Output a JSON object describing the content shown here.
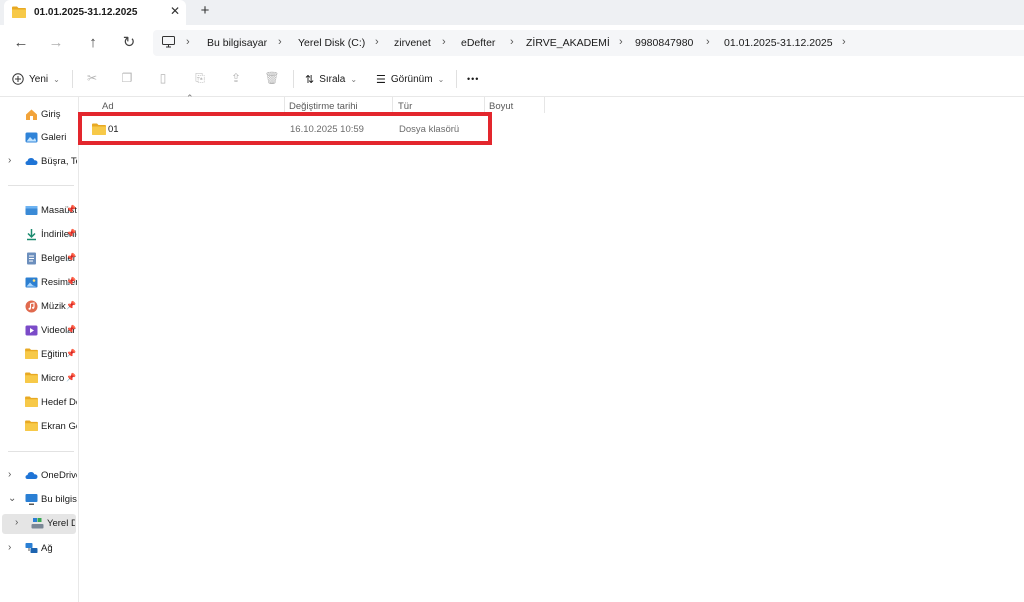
{
  "tab": {
    "title": "01.01.2025-31.12.2025",
    "close_glyph": "✕",
    "new_tab_glyph": "+"
  },
  "nav": {
    "back": "←",
    "forward": "→",
    "up": "↑",
    "refresh": "↻"
  },
  "breadcrumb": [
    "Bu bilgisayar",
    "Yerel Disk (C:)",
    "zirvenet",
    "eDefter",
    "ZİRVE_AKADEMİ",
    "9980847980",
    "01.01.2025-31.12.2025"
  ],
  "breadcrumb_sep": "›",
  "commandbar": {
    "new_label": "Yeni",
    "sort_label": "Sırala",
    "view_label": "Görünüm",
    "more": "•••",
    "icons": [
      "cut-icon",
      "copy-icon",
      "paste-icon",
      "rename-icon",
      "share-icon",
      "delete-icon"
    ]
  },
  "sidebar": {
    "items": [
      {
        "label": "Giriş",
        "icon": "home-icon"
      },
      {
        "label": "Galeri",
        "icon": "gallery-icon"
      },
      {
        "label": "Büşra, Te",
        "icon": "onedrive-icon"
      },
      {
        "label": "Masaüstü",
        "icon": "desktop-icon"
      },
      {
        "label": "İndirilenler",
        "icon": "download-icon"
      },
      {
        "label": "Belgeler",
        "icon": "documents-icon"
      },
      {
        "label": "Resimler",
        "icon": "pictures-icon"
      },
      {
        "label": "Müzik",
        "icon": "music-icon"
      },
      {
        "label": "Videolar",
        "icon": "videos-icon"
      },
      {
        "label": "Eğitim",
        "icon": "folder-icon"
      },
      {
        "label": "Micro",
        "icon": "folder-icon"
      },
      {
        "label": "Hedef De",
        "icon": "folder-icon"
      },
      {
        "label": "Ekran Gö",
        "icon": "folder-icon"
      },
      {
        "label": "OneDrive",
        "icon": "onedrive-icon"
      },
      {
        "label": "Bu bilgis",
        "icon": "pc-icon"
      },
      {
        "label": "Yerel Di",
        "icon": "drive-icon"
      },
      {
        "label": "Ağ",
        "icon": "network-icon"
      }
    ],
    "pin_glyph": "📌"
  },
  "columns": {
    "name": "Ad",
    "date": "Değiştirme tarihi",
    "type": "Tür",
    "size": "Boyut"
  },
  "files": [
    {
      "name": "01",
      "date": "16.10.2025 10:59",
      "type": "Dosya klasörü",
      "size": ""
    }
  ],
  "colors": {
    "accent": "#0067c0",
    "highlight": "#e3262d",
    "folder": "#f3c13a"
  }
}
